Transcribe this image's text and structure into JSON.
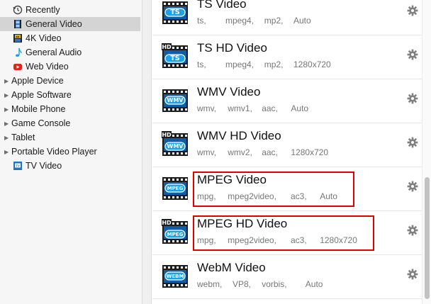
{
  "sidebar": {
    "items": [
      {
        "label": "Recently",
        "icon": "clock-icon"
      },
      {
        "label": "General Video",
        "icon": "film-icon"
      },
      {
        "label": "4K Video",
        "icon": "4k-film-icon"
      },
      {
        "label": "General Audio",
        "icon": "music-note-icon"
      },
      {
        "label": "Web Video",
        "icon": "youtube-icon"
      },
      {
        "label": "Apple Device",
        "icon": "disclosure-triangle-icon"
      },
      {
        "label": "Apple Software",
        "icon": "disclosure-triangle-icon"
      },
      {
        "label": "Mobile Phone",
        "icon": "disclosure-triangle-icon"
      },
      {
        "label": "Game Console",
        "icon": "disclosure-triangle-icon"
      },
      {
        "label": "Tablet",
        "icon": "disclosure-triangle-icon"
      },
      {
        "label": "Portable Video Player",
        "icon": "disclosure-triangle-icon"
      },
      {
        "label": "TV Video",
        "icon": "tv-icon"
      }
    ],
    "selected": "General Video"
  },
  "formats": [
    {
      "title": "TS Video",
      "badge": "TS",
      "hd": false,
      "meta": [
        "ts,",
        "mpeg4,",
        "mp2,",
        "Auto"
      ],
      "highlight": false
    },
    {
      "title": "TS HD Video",
      "badge": "TS",
      "hd": true,
      "meta": [
        "ts,",
        "mpeg4,",
        "mp2,",
        "1280x720"
      ],
      "highlight": false
    },
    {
      "title": "WMV Video",
      "badge": "WMV",
      "hd": false,
      "meta": [
        "wmv,",
        "wmv1,",
        "aac,",
        "Auto"
      ],
      "highlight": false
    },
    {
      "title": "WMV HD Video",
      "badge": "WMV",
      "hd": true,
      "meta": [
        "wmv,",
        "wmv2,",
        "aac,",
        "1280x720"
      ],
      "highlight": false
    },
    {
      "title": "MPEG Video",
      "badge": "MPEG",
      "hd": false,
      "meta": [
        "mpg,",
        "mpeg2video,",
        "ac3,",
        "Auto"
      ],
      "highlight": true
    },
    {
      "title": "MPEG HD Video",
      "badge": "MPEG",
      "hd": true,
      "meta": [
        "mpg,",
        "mpeg2video,",
        "ac3,",
        "1280x720"
      ],
      "highlight": true
    },
    {
      "title": "WebM Video",
      "badge": "WEBM",
      "hd": false,
      "meta": [
        "webm,",
        "VP8,",
        "vorbis,",
        "Auto"
      ],
      "highlight": false
    }
  ],
  "colors": {
    "highlight": "#e00000",
    "selected_row": "#d4d4d4",
    "badge_blue": "#1aa3e8"
  }
}
